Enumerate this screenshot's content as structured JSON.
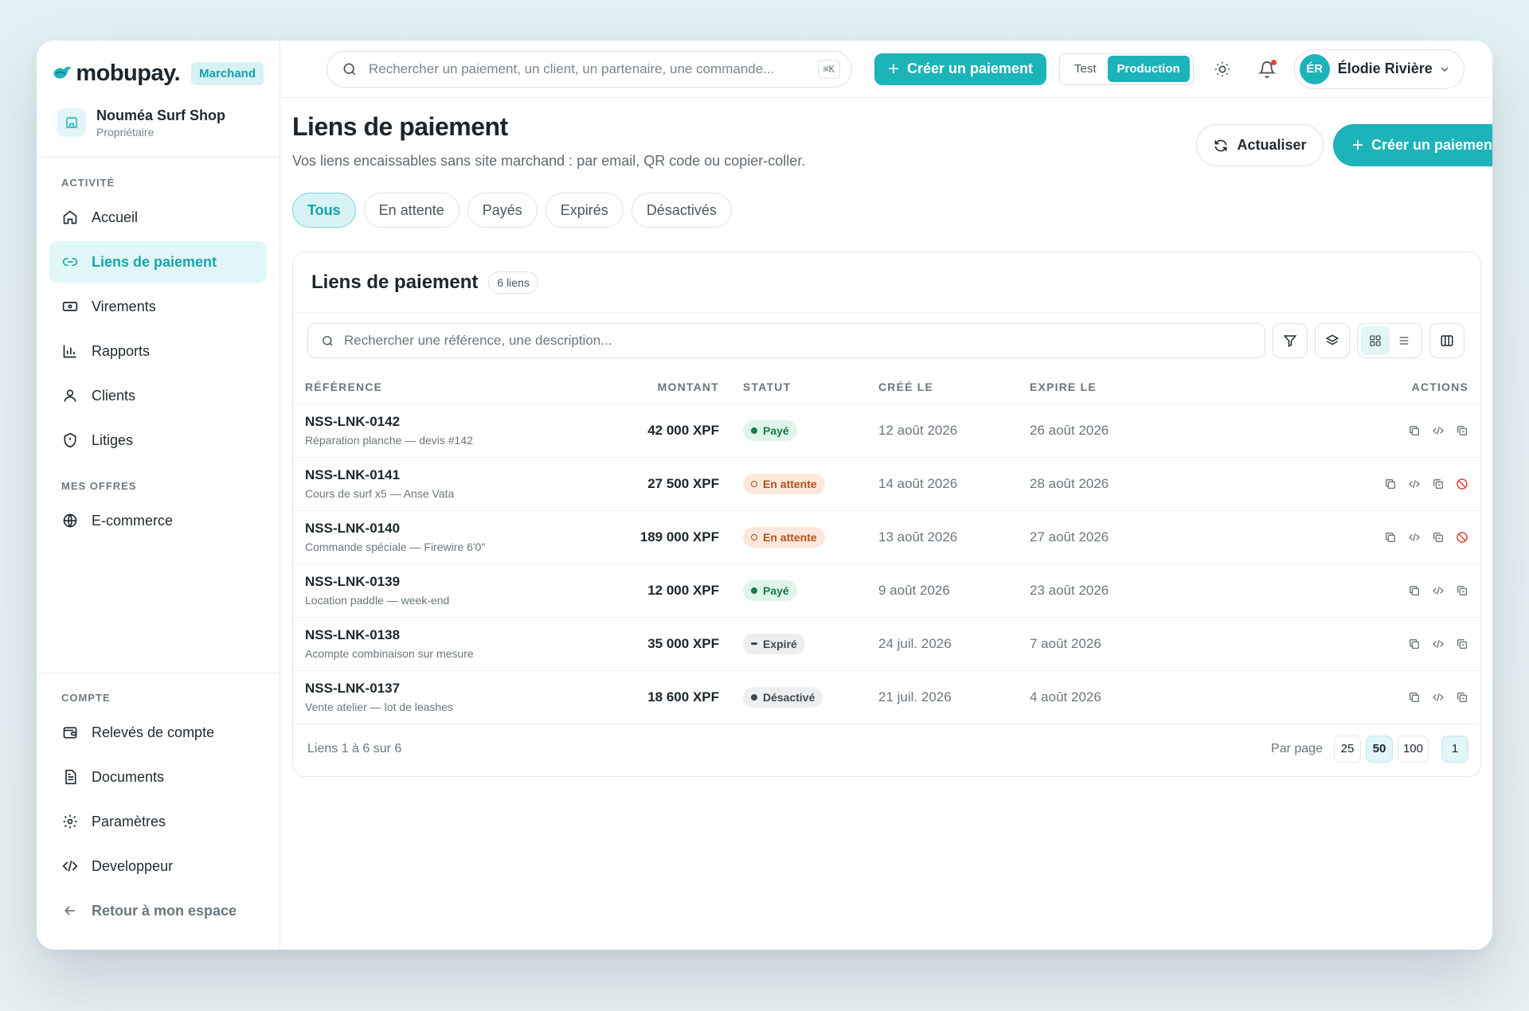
{
  "brand": {
    "name": "mobupay.",
    "badge": "Marchand"
  },
  "shop": {
    "name": "Nouméa Surf Shop",
    "role": "Propriétaire"
  },
  "sidebar": {
    "activity_label": "ACTIVITÉ",
    "activity_items": [
      {
        "label": "Accueil",
        "icon": "home-icon"
      },
      {
        "label": "Liens de paiement",
        "icon": "link-icon"
      },
      {
        "label": "Virements",
        "icon": "transfer-icon"
      },
      {
        "label": "Rapports",
        "icon": "chart-icon"
      },
      {
        "label": "Clients",
        "icon": "user-icon"
      },
      {
        "label": "Litiges",
        "icon": "shield-icon"
      }
    ],
    "offers_label": "MES OFFRES",
    "offers_items": [
      {
        "label": "E-commerce",
        "icon": "globe-icon"
      }
    ],
    "account_label": "COMPTE",
    "account_items": [
      {
        "label": "Relevés de compte",
        "icon": "wallet-icon"
      },
      {
        "label": "Documents",
        "icon": "document-icon"
      },
      {
        "label": "Paramètres",
        "icon": "gear-icon"
      },
      {
        "label": "Developpeur",
        "icon": "code-icon"
      }
    ],
    "back_label": "Retour à mon espace"
  },
  "topbar": {
    "search_placeholder": "Rechercher un paiement, un client, un partenaire, une commande...",
    "shortcut": "⌘K",
    "create_label": "Créer un paiement",
    "env_test": "Test",
    "env_prod": "Production",
    "user_initials": "ÉR",
    "user_name": "Élodie Rivière"
  },
  "page": {
    "title": "Liens de paiement",
    "subtitle": "Vos liens encaissables sans site marchand : par email, QR code ou copier-coller.",
    "refresh_label": "Actualiser",
    "create_label": "Créer un paiement",
    "tabs": [
      "Tous",
      "En attente",
      "Payés",
      "Expirés",
      "Désactivés"
    ],
    "active_tab": "Tous"
  },
  "card": {
    "title": "Liens de paiement",
    "count": "6 liens",
    "search_placeholder": "Rechercher une référence, une description...",
    "columns": [
      "RÉFÉRENCE",
      "MONTANT",
      "STATUT",
      "CRÉÉ LE",
      "EXPIRE LE",
      "ACTIONS"
    ],
    "rows": [
      {
        "ref": "NSS-LNK-0142",
        "desc": "Réparation planche — devis #142",
        "amount": "42 000 XPF",
        "status": "Payé",
        "status_type": "paid",
        "created": "12 août 2026",
        "expires": "26 août 2026"
      },
      {
        "ref": "NSS-LNK-0141",
        "desc": "Cours de surf x5 — Anse Vata",
        "amount": "27 500 XPF",
        "status": "En attente",
        "status_type": "pending",
        "created": "14 août 2026",
        "expires": "28 août 2026"
      },
      {
        "ref": "NSS-LNK-0140",
        "desc": "Commande spéciale — Firewire 6'0\"",
        "amount": "189 000 XPF",
        "status": "En attente",
        "status_type": "pending",
        "created": "13 août 2026",
        "expires": "27 août 2026"
      },
      {
        "ref": "NSS-LNK-0139",
        "desc": "Location paddle — week-end",
        "amount": "12 000 XPF",
        "status": "Payé",
        "status_type": "paid",
        "created": "9 août 2026",
        "expires": "23 août 2026"
      },
      {
        "ref": "NSS-LNK-0138",
        "desc": "Acompte combinaison sur mesure",
        "amount": "35 000 XPF",
        "status": "Expiré",
        "status_type": "expired",
        "created": "24 juil. 2026",
        "expires": "7 août 2026"
      },
      {
        "ref": "NSS-LNK-0137",
        "desc": "Vente atelier — lot de leashes",
        "amount": "18 600 XPF",
        "status": "Désactivé",
        "status_type": "disabled",
        "created": "21 juil. 2026",
        "expires": "4 août 2026"
      }
    ],
    "footer_text": "Liens 1 à 6 sur 6",
    "per_page_label": "Par page",
    "per_page_options": [
      "25",
      "50",
      "100"
    ],
    "per_page_selected": "50",
    "current_page": "1"
  },
  "colors": {
    "accent": "#1cb3b9",
    "danger": "#e0433d"
  }
}
